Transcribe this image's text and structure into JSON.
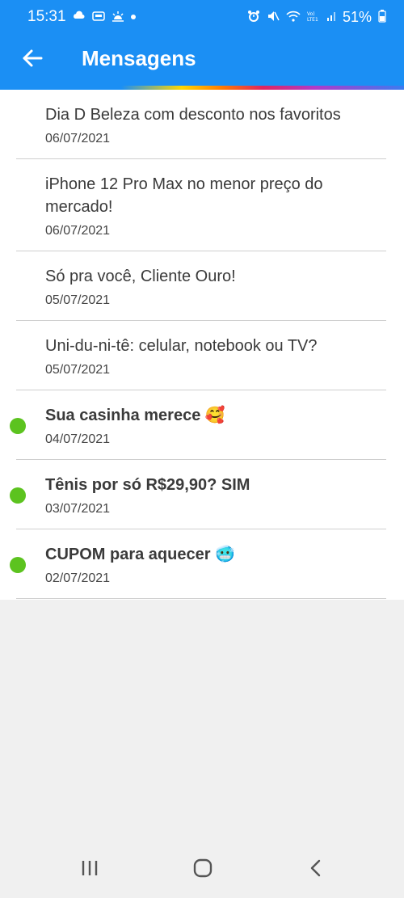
{
  "status_bar": {
    "time": "15:31",
    "battery": "51%",
    "left_icons": [
      "weather-icon",
      "app-icon",
      "sun-icon",
      "dot-icon"
    ],
    "right_icons": [
      "alarm-icon",
      "mute-icon",
      "wifi-icon",
      "volte-icon",
      "signal-icon",
      "battery-icon"
    ]
  },
  "header": {
    "title": "Mensagens",
    "background_color": "#1b8ff4"
  },
  "messages": [
    {
      "title": "Dia D Beleza com desconto nos favoritos",
      "date": "06/07/2021",
      "unread": false
    },
    {
      "title": "iPhone 12 Pro Max no menor preço do mercado!",
      "date": "06/07/2021",
      "unread": false
    },
    {
      "title": "Só pra você, Cliente Ouro!",
      "date": "05/07/2021",
      "unread": false
    },
    {
      "title": "Uni-du-ni-tê: celular, notebook ou TV?",
      "date": "05/07/2021",
      "unread": false
    },
    {
      "title": "Sua casinha merece 🥰",
      "date": "04/07/2021",
      "unread": true
    },
    {
      "title": "Tênis por só R$29,90? SIM",
      "date": "03/07/2021",
      "unread": true
    },
    {
      "title": "CUPOM para aquecer 🥶",
      "date": "02/07/2021",
      "unread": true
    }
  ],
  "colors": {
    "unread_dot": "#5cc31f",
    "divider": "#cfcfcf"
  },
  "nav_bar": {
    "buttons": [
      "recents-icon",
      "home-icon",
      "back-nav-icon"
    ]
  }
}
